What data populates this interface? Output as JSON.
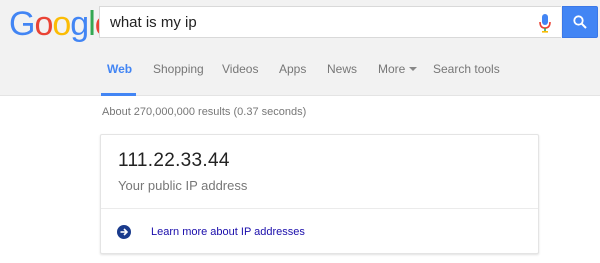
{
  "logo": {
    "letters": [
      {
        "char": "G",
        "color": "#4285f4"
      },
      {
        "char": "o",
        "color": "#ea4335"
      },
      {
        "char": "o",
        "color": "#fbbc05"
      },
      {
        "char": "g",
        "color": "#4285f4"
      },
      {
        "char": "l",
        "color": "#34a853"
      },
      {
        "char": "e",
        "color": "#ea4335"
      }
    ]
  },
  "search": {
    "query": "what is my ip"
  },
  "tabs": [
    {
      "label": "Web",
      "active": true
    },
    {
      "label": "Shopping"
    },
    {
      "label": "Videos"
    },
    {
      "label": "Apps"
    },
    {
      "label": "News"
    },
    {
      "label": "More"
    },
    {
      "label": "Search tools"
    }
  ],
  "result_stats": "About 270,000,000 results (0.37 seconds)",
  "ip_card": {
    "ip": "111.22.33.44",
    "caption": "Your public IP address",
    "learn_more": "Learn more about IP addresses"
  },
  "colors": {
    "accent": "#4285f4",
    "link": "#1a0dab"
  }
}
